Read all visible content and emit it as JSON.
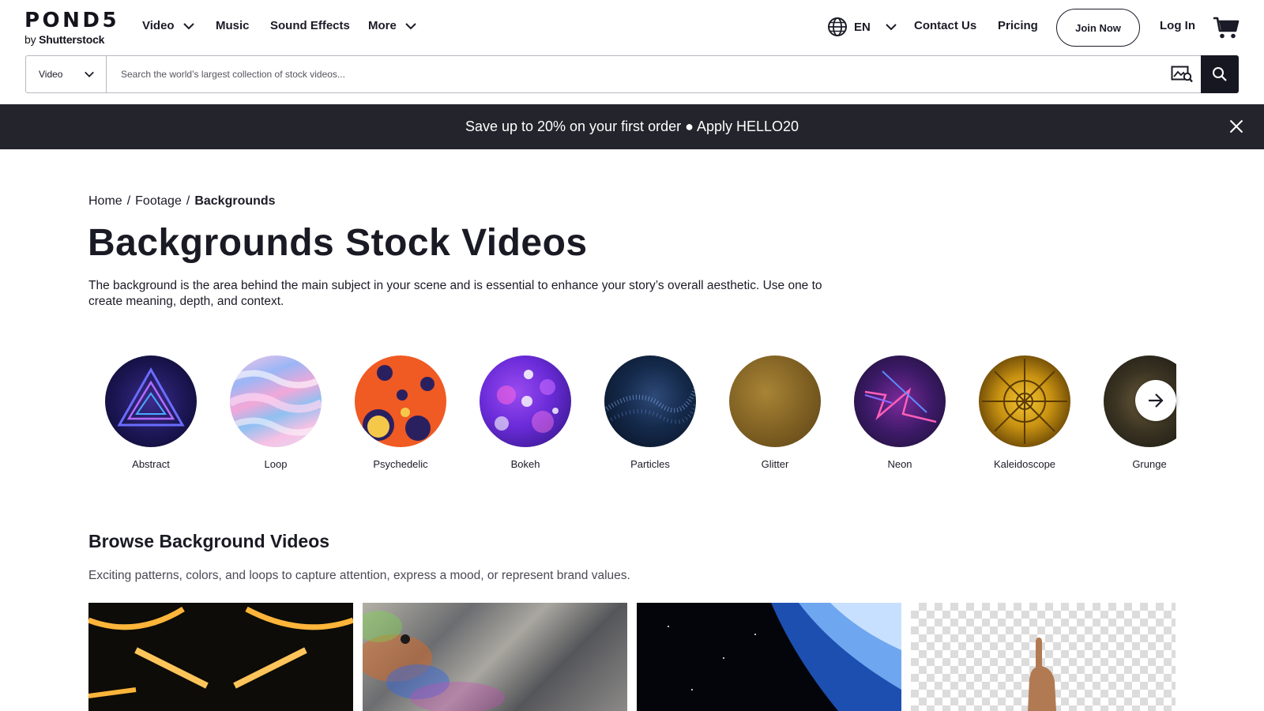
{
  "brand": {
    "name": "POND5",
    "sub_prefix": "by ",
    "sub_brand": "Shutterstock"
  },
  "nav": {
    "video": "Video",
    "music": "Music",
    "sound_effects": "Sound Effects",
    "more": "More",
    "language": "EN",
    "contact": "Contact Us",
    "pricing": "Pricing",
    "join": "Join Now",
    "login": "Log In"
  },
  "search": {
    "type_selected": "Video",
    "placeholder": "Search the world’s largest collection of stock videos..."
  },
  "promo": {
    "text": "Save up to 20% on your first order ● Apply HELLO20"
  },
  "breadcrumb": {
    "home": "Home",
    "footage": "Footage",
    "current": "Backgrounds",
    "separator": "/"
  },
  "page": {
    "title": "Backgrounds Stock Videos",
    "description": "The background is the area behind the main subject in your scene and is essential to enhance your story’s overall aesthetic. Use one to create meaning, depth, and context."
  },
  "categories": [
    {
      "label": "Abstract"
    },
    {
      "label": "Loop"
    },
    {
      "label": "Psychedelic"
    },
    {
      "label": "Bokeh"
    },
    {
      "label": "Particles"
    },
    {
      "label": "Glitter"
    },
    {
      "label": "Neon"
    },
    {
      "label": "Kaleidoscope"
    },
    {
      "label": "Grunge"
    }
  ],
  "browse": {
    "title": "Browse Background Videos",
    "description": "Exciting patterns, colors, and loops to capture attention, express a mood, or represent brand values."
  },
  "colors": {
    "promo_bg": "#24242d",
    "text_dark": "#1a1a24",
    "search_button": "#171722"
  }
}
